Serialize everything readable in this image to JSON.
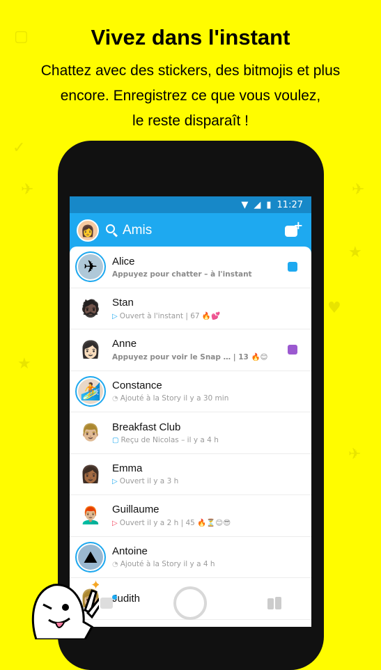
{
  "headline": "Vivez dans l'instant",
  "subtitle_lines": [
    "Chattez avec des stickers, des bitmojis et plus",
    "encore. Enregistrez ce que vous voulez,",
    "le reste disparaît !"
  ],
  "statusbar": {
    "time": "11:27"
  },
  "appbar": {
    "title": "Amis"
  },
  "friends": [
    {
      "name": "Alice",
      "status": "Appuyez pour chatter – à l'instant",
      "bold": true,
      "arrow": "",
      "indicator": "#1EA9F0"
    },
    {
      "name": "Stan",
      "status": "Ouvert à l'instant  |  67 🔥💕",
      "arrow": "▷",
      "arrow_color": "#1EA9F0"
    },
    {
      "name": "Anne",
      "status": "Appuyez pour voir le Snap …  |  13 🔥😊",
      "bold": true,
      "arrow": "",
      "indicator": "#9B59D0"
    },
    {
      "name": "Constance",
      "status": "Ajouté à la Story il y a 30 min",
      "arrow": "◔",
      "arrow_color": "#bbb"
    },
    {
      "name": "Breakfast Club",
      "status": "Reçu de Nicolas – il y a 4 h",
      "arrow": "▢",
      "arrow_color": "#1EA9F0"
    },
    {
      "name": "Emma",
      "status": "Ouvert il y a 3 h",
      "arrow": "▷",
      "arrow_color": "#1EA9F0"
    },
    {
      "name": "Guillaume",
      "status": "Ouvert il y a 2 h  |  45 🔥⏳😊😎",
      "arrow": "▷",
      "arrow_color": "#F23C57"
    },
    {
      "name": "Antoine",
      "status": "Ajouté à la Story il y a 4 h",
      "arrow": "◔",
      "arrow_color": "#bbb"
    },
    {
      "name": "Judith",
      "status": "",
      "arrow": ""
    }
  ],
  "colors": {
    "brand_yellow": "#FFFC00",
    "accent_blue": "#1EA9F0",
    "purple": "#9B59D0",
    "red": "#F23C57"
  }
}
